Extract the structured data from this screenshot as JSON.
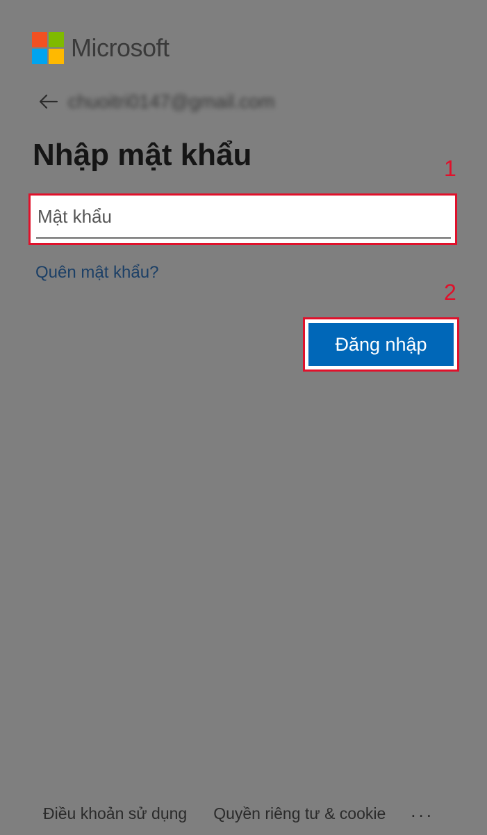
{
  "brand": {
    "name": "Microsoft",
    "logo_colors": [
      "#f25022",
      "#7fba00",
      "#00a4ef",
      "#ffb900"
    ]
  },
  "identity": {
    "email": "chuoitri0147@gmail.com",
    "back_icon": "arrow-left-icon"
  },
  "page_title": "Nhập mật khẩu",
  "password_field": {
    "value": "",
    "placeholder": "Mật khẩu"
  },
  "forgot_password_label": "Quên mật khẩu?",
  "signin_button_label": "Đăng nhập",
  "annotations": {
    "step_1": "1",
    "step_2": "2",
    "highlight_color": "#e0112b"
  },
  "footer": {
    "terms_label": "Điều khoản sử dụng",
    "privacy_label": "Quyền riêng tư & cookie",
    "more_label": "..."
  },
  "colors": {
    "background": "#7f7f7f",
    "primary_button": "#0067b8",
    "link": "#1b3f66"
  }
}
